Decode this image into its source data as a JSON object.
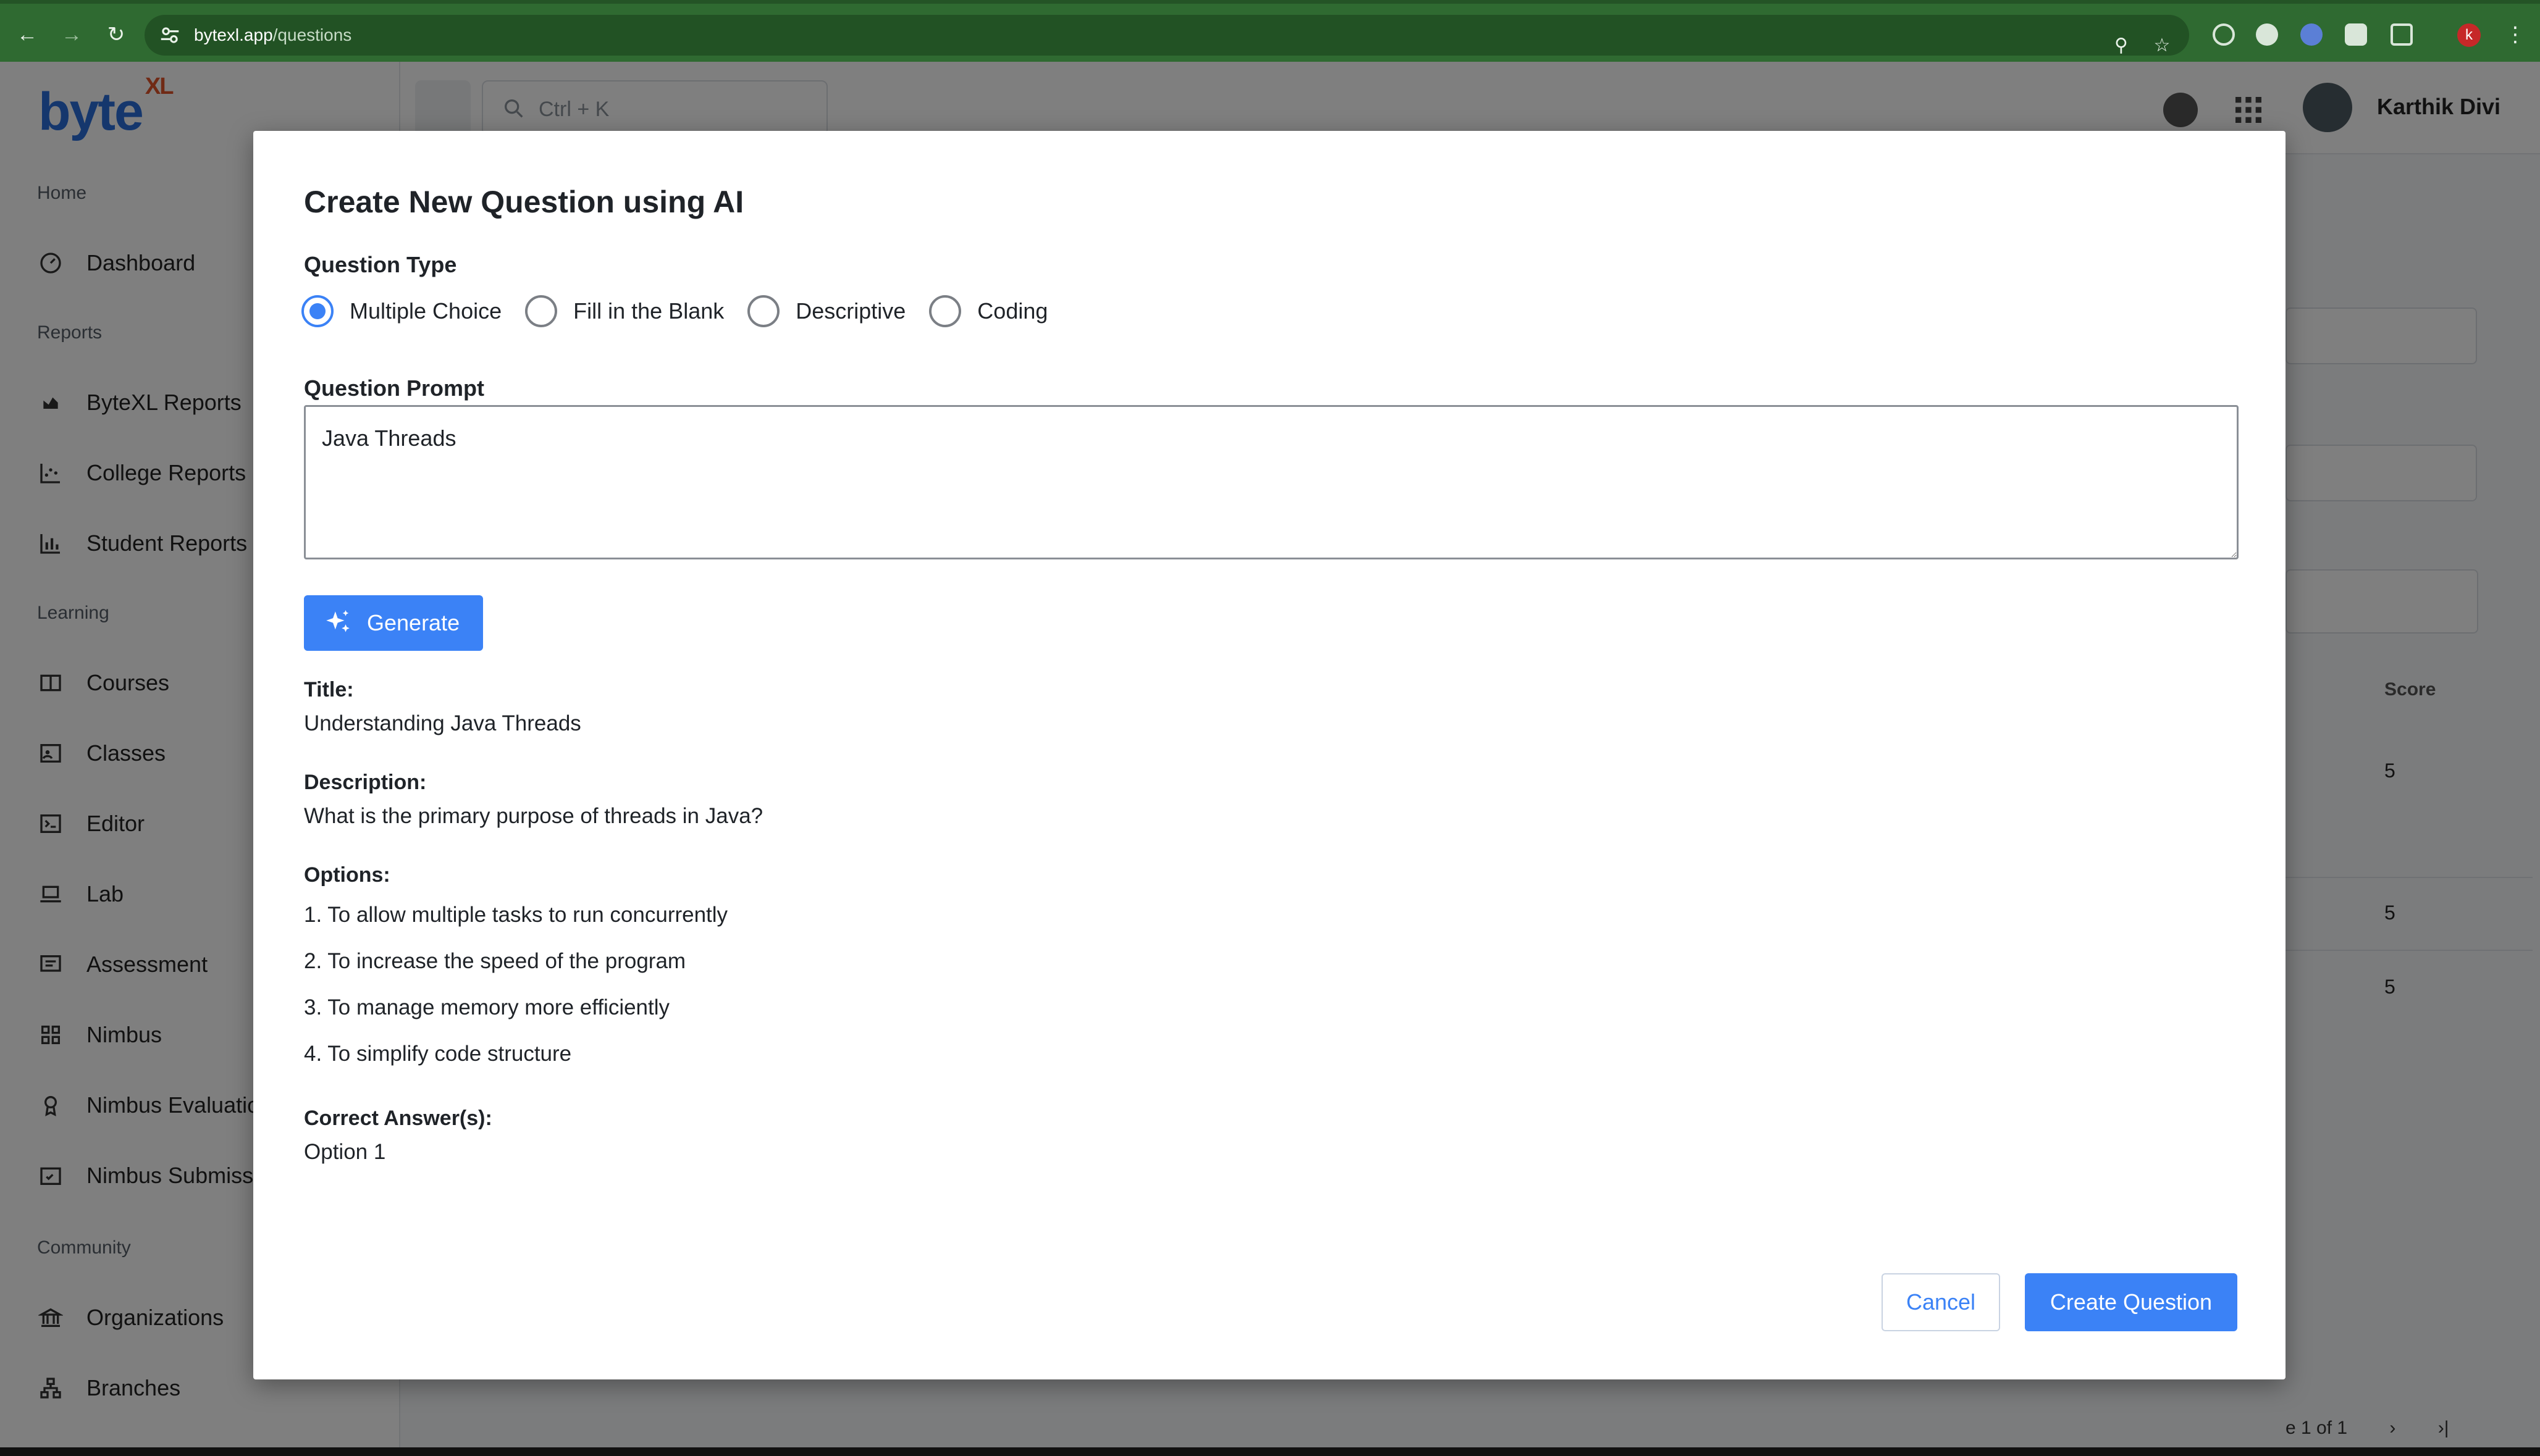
{
  "browser": {
    "url_host": "bytexl.app",
    "url_path": "/questions",
    "profile_initial": "k"
  },
  "app": {
    "logo_text": "byte",
    "logo_sup": "XL",
    "search_placeholder": "Ctrl + K",
    "user_name": "Karthik Divi",
    "sidebar": {
      "sections": [
        {
          "label": "Home",
          "items": [
            {
              "label": "Dashboard",
              "icon": "dashboard-icon"
            }
          ]
        },
        {
          "label": "Reports",
          "items": [
            {
              "label": "ByteXL Reports",
              "icon": "chart-icon"
            },
            {
              "label": "College Reports",
              "icon": "scatter-chart-icon"
            },
            {
              "label": "Student Reports",
              "icon": "bar-chart-icon"
            }
          ]
        },
        {
          "label": "Learning",
          "items": [
            {
              "label": "Courses",
              "icon": "book-icon"
            },
            {
              "label": "Classes",
              "icon": "classroom-icon"
            },
            {
              "label": "Editor",
              "icon": "terminal-icon"
            },
            {
              "label": "Lab",
              "icon": "laptop-icon"
            },
            {
              "label": "Assessment",
              "icon": "assessment-icon"
            },
            {
              "label": "Nimbus",
              "icon": "grid-icon"
            },
            {
              "label": "Nimbus Evaluatio",
              "icon": "award-icon"
            },
            {
              "label": "Nimbus Submiss",
              "icon": "calendar-check-icon"
            }
          ]
        },
        {
          "label": "Community",
          "items": [
            {
              "label": "Organizations",
              "icon": "bank-icon"
            },
            {
              "label": "Branches",
              "icon": "hierarchy-icon"
            }
          ]
        }
      ]
    },
    "background_table": {
      "score_header": "Score",
      "scores": [
        "5",
        "5",
        "5"
      ],
      "pager_text": "e 1 of 1"
    }
  },
  "modal": {
    "title": "Create New Question using AI",
    "question_type_label": "Question Type",
    "question_types": [
      {
        "label": "Multiple Choice",
        "checked": true
      },
      {
        "label": "Fill in the Blank",
        "checked": false
      },
      {
        "label": "Descriptive",
        "checked": false
      },
      {
        "label": "Coding",
        "checked": false
      }
    ],
    "prompt_label": "Question Prompt",
    "prompt_value": "Java Threads",
    "generate_label": "Generate",
    "title_label": "Title:",
    "title_value": "Understanding Java Threads",
    "description_label": "Description:",
    "description_value": "What is the primary purpose of threads in Java?",
    "options_label": "Options:",
    "options": [
      "1. To allow multiple tasks to run concurrently",
      "2. To increase the speed of the program",
      "3. To manage memory more efficiently",
      "4. To simplify code structure"
    ],
    "correct_label": "Correct Answer(s):",
    "correct_value": "Option 1",
    "cancel_label": "Cancel",
    "create_label": "Create Question"
  },
  "colors": {
    "accent": "#3b82f6",
    "chrome": "#2f6a31",
    "overlay": "rgba(0,0,0,0.5)"
  }
}
